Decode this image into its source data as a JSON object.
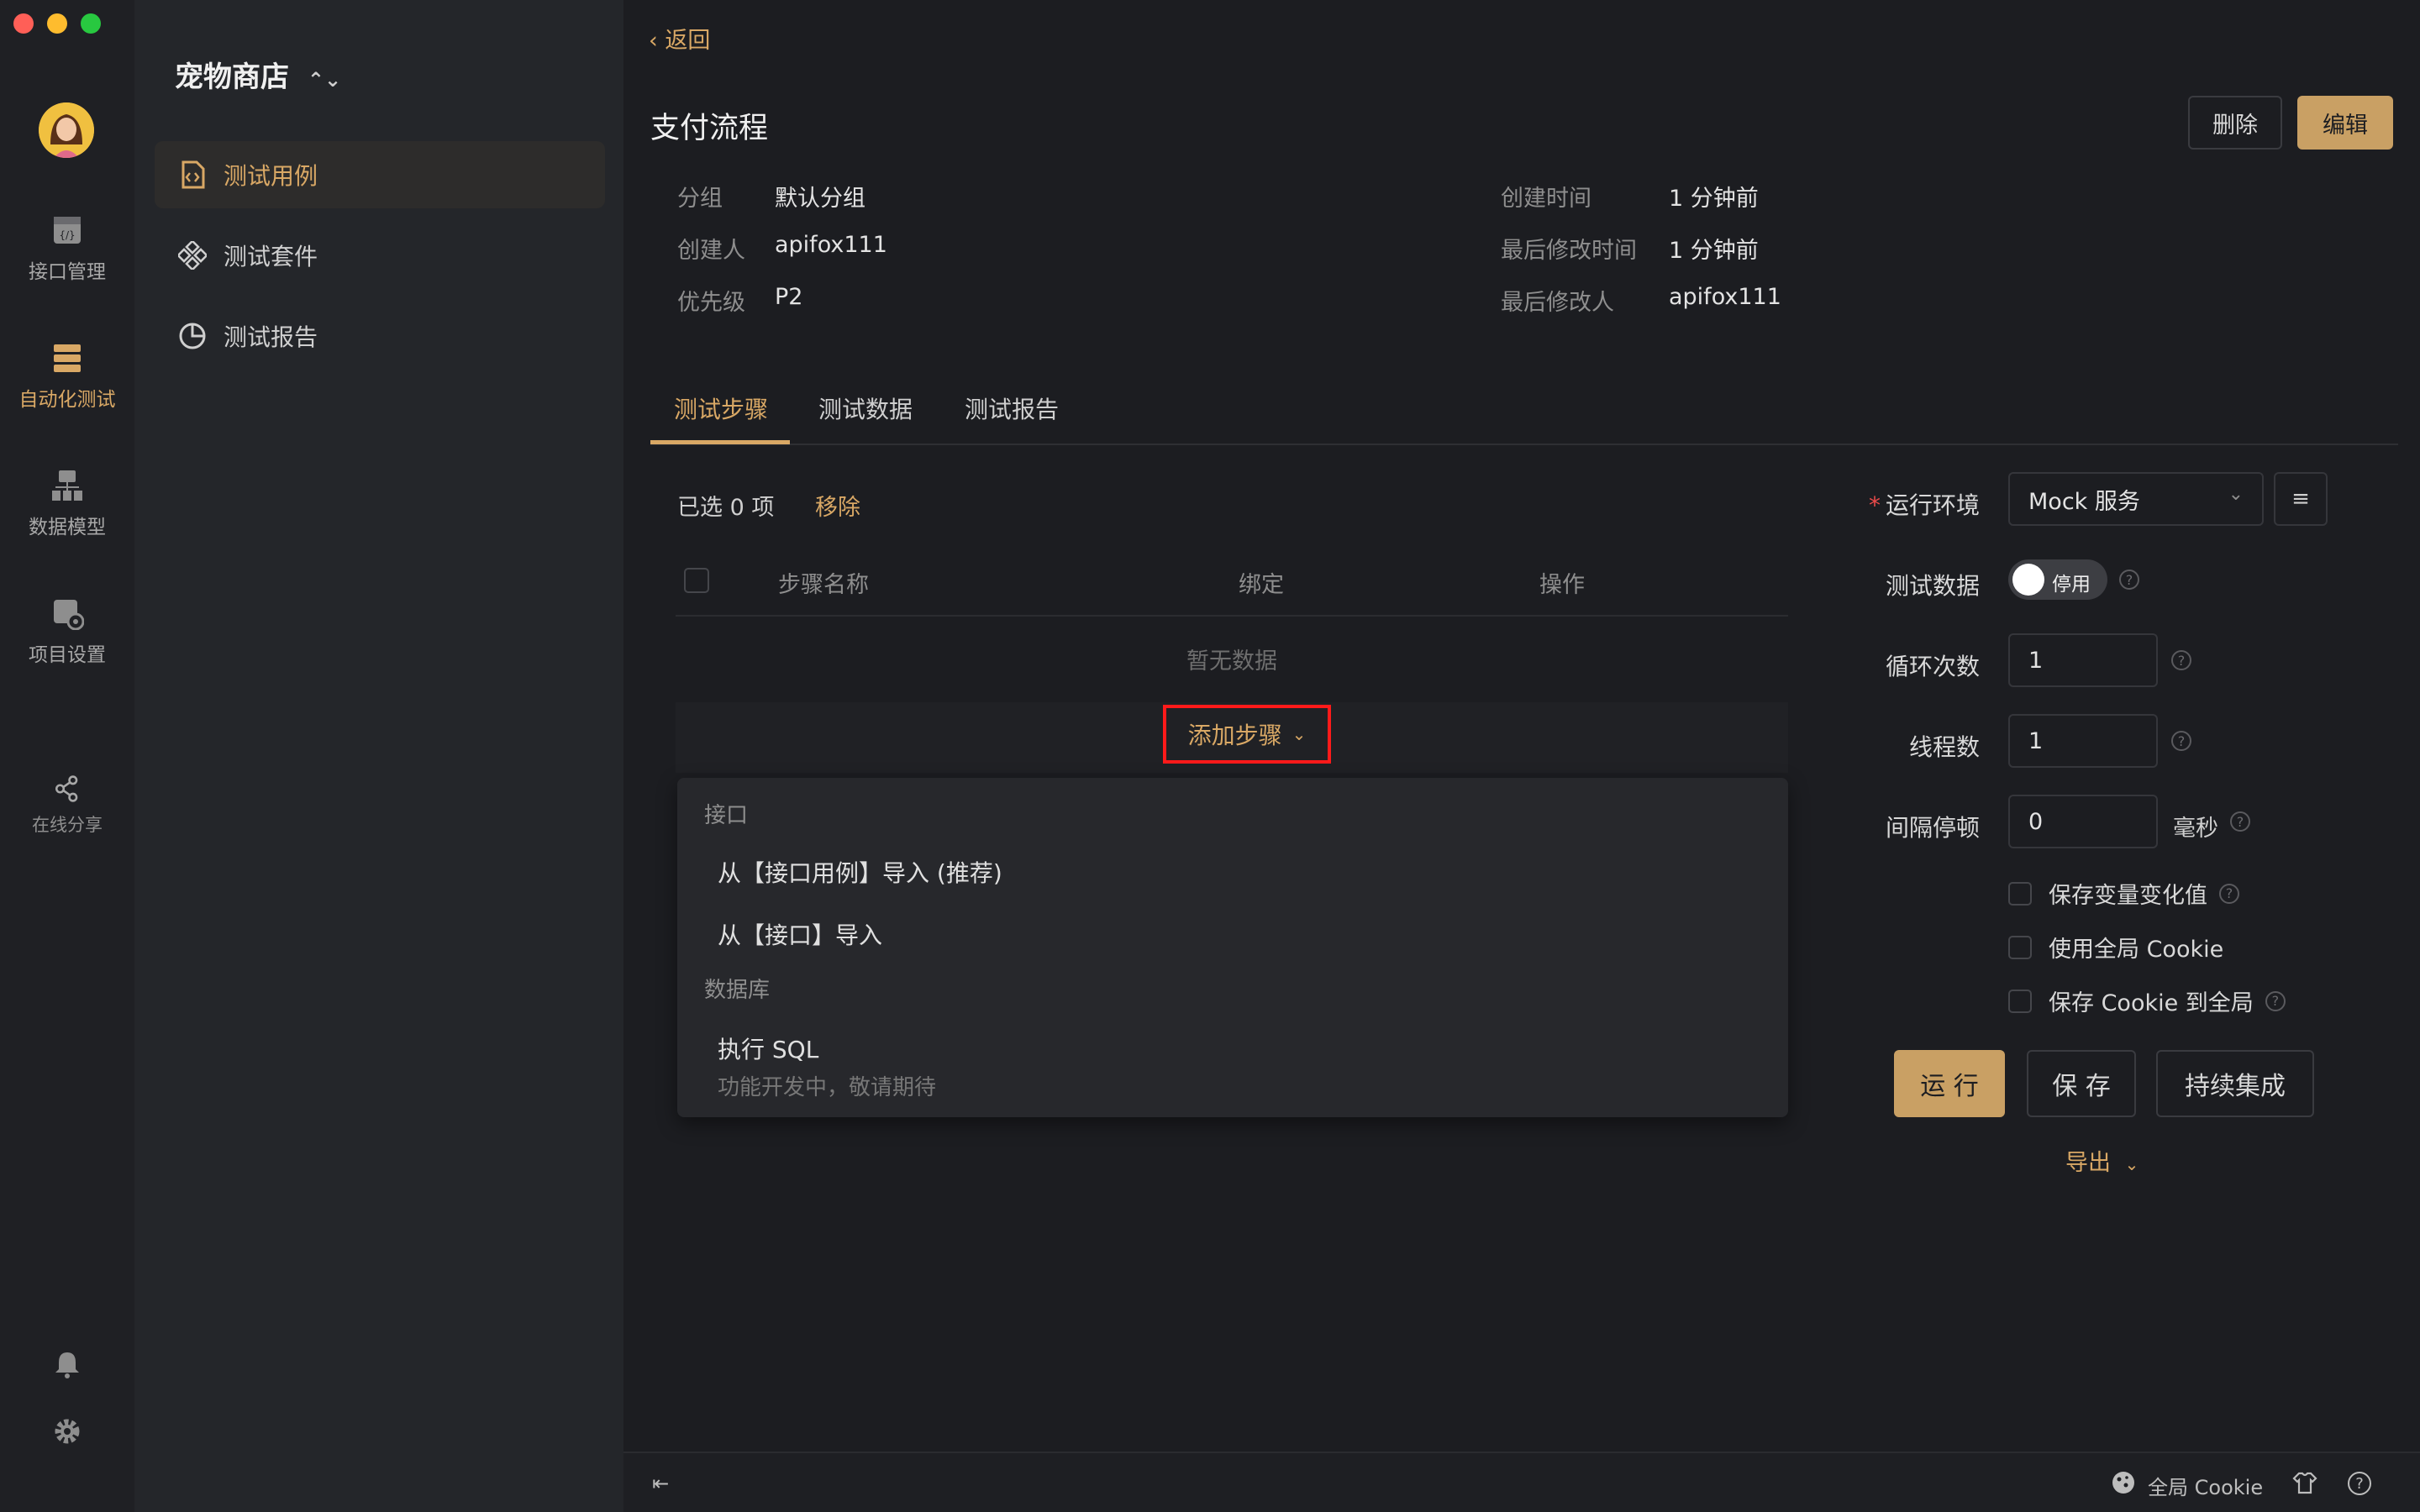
{
  "rail": {
    "items": [
      {
        "label": "接口管理",
        "icon": "api-icon"
      },
      {
        "label": "自动化测试",
        "icon": "automation-icon",
        "active": true
      },
      {
        "label": "数据模型",
        "icon": "data-model-icon"
      },
      {
        "label": "项目设置",
        "icon": "settings-project-icon"
      },
      {
        "label": "在线分享",
        "icon": "share-icon"
      }
    ]
  },
  "project": {
    "name": "宠物商店"
  },
  "sidebar": {
    "items": [
      {
        "label": "测试用例",
        "active": true
      },
      {
        "label": "测试套件"
      },
      {
        "label": "测试报告"
      }
    ]
  },
  "header": {
    "back": "返回",
    "title": "支付流程",
    "delete_label": "删除",
    "edit_label": "编辑"
  },
  "meta": {
    "group_label": "分组",
    "group_value": "默认分组",
    "creator_label": "创建人",
    "creator_value": "apifox111",
    "priority_label": "优先级",
    "priority_value": "P2",
    "created_label": "创建时间",
    "created_value": "1 分钟前",
    "modified_label": "最后修改时间",
    "modified_value": "1 分钟前",
    "modifier_label": "最后修改人",
    "modifier_value": "apifox111"
  },
  "tabs": [
    {
      "label": "测试步骤",
      "active": true
    },
    {
      "label": "测试数据"
    },
    {
      "label": "测试报告"
    }
  ],
  "steps": {
    "selected": "已选 0 项",
    "remove": "移除",
    "columns": [
      "步骤名称",
      "绑定",
      "操作"
    ],
    "empty": "暂无数据",
    "add_label": "添加步骤"
  },
  "dropdown": {
    "group1": "接口",
    "item1": "从【接口用例】导入 (推荐)",
    "item2": "从【接口】导入",
    "group2": "数据库",
    "item3": "执行 SQL",
    "item3_desc": "功能开发中，敬请期待"
  },
  "run_panel": {
    "env_label": "运行环境",
    "env_value": "Mock 服务",
    "testdata_label": "测试数据",
    "testdata_toggle": "停用",
    "loop_label": "循环次数",
    "loop_value": "1",
    "thread_label": "线程数",
    "thread_value": "1",
    "interval_label": "间隔停顿",
    "interval_value": "0",
    "interval_unit": "毫秒",
    "opt1": "保存变量变化值",
    "opt2": "使用全局 Cookie",
    "opt3": "保存 Cookie 到全局",
    "run_label": "运 行",
    "save_label": "保 存",
    "ci_label": "持续集成",
    "export_label": "导出"
  },
  "footer": {
    "cookie_label": "全局 Cookie"
  },
  "colors": {
    "accent": "#d9a865",
    "primary_btn": "#c9a064",
    "highlight_box": "#ff1a1a"
  }
}
